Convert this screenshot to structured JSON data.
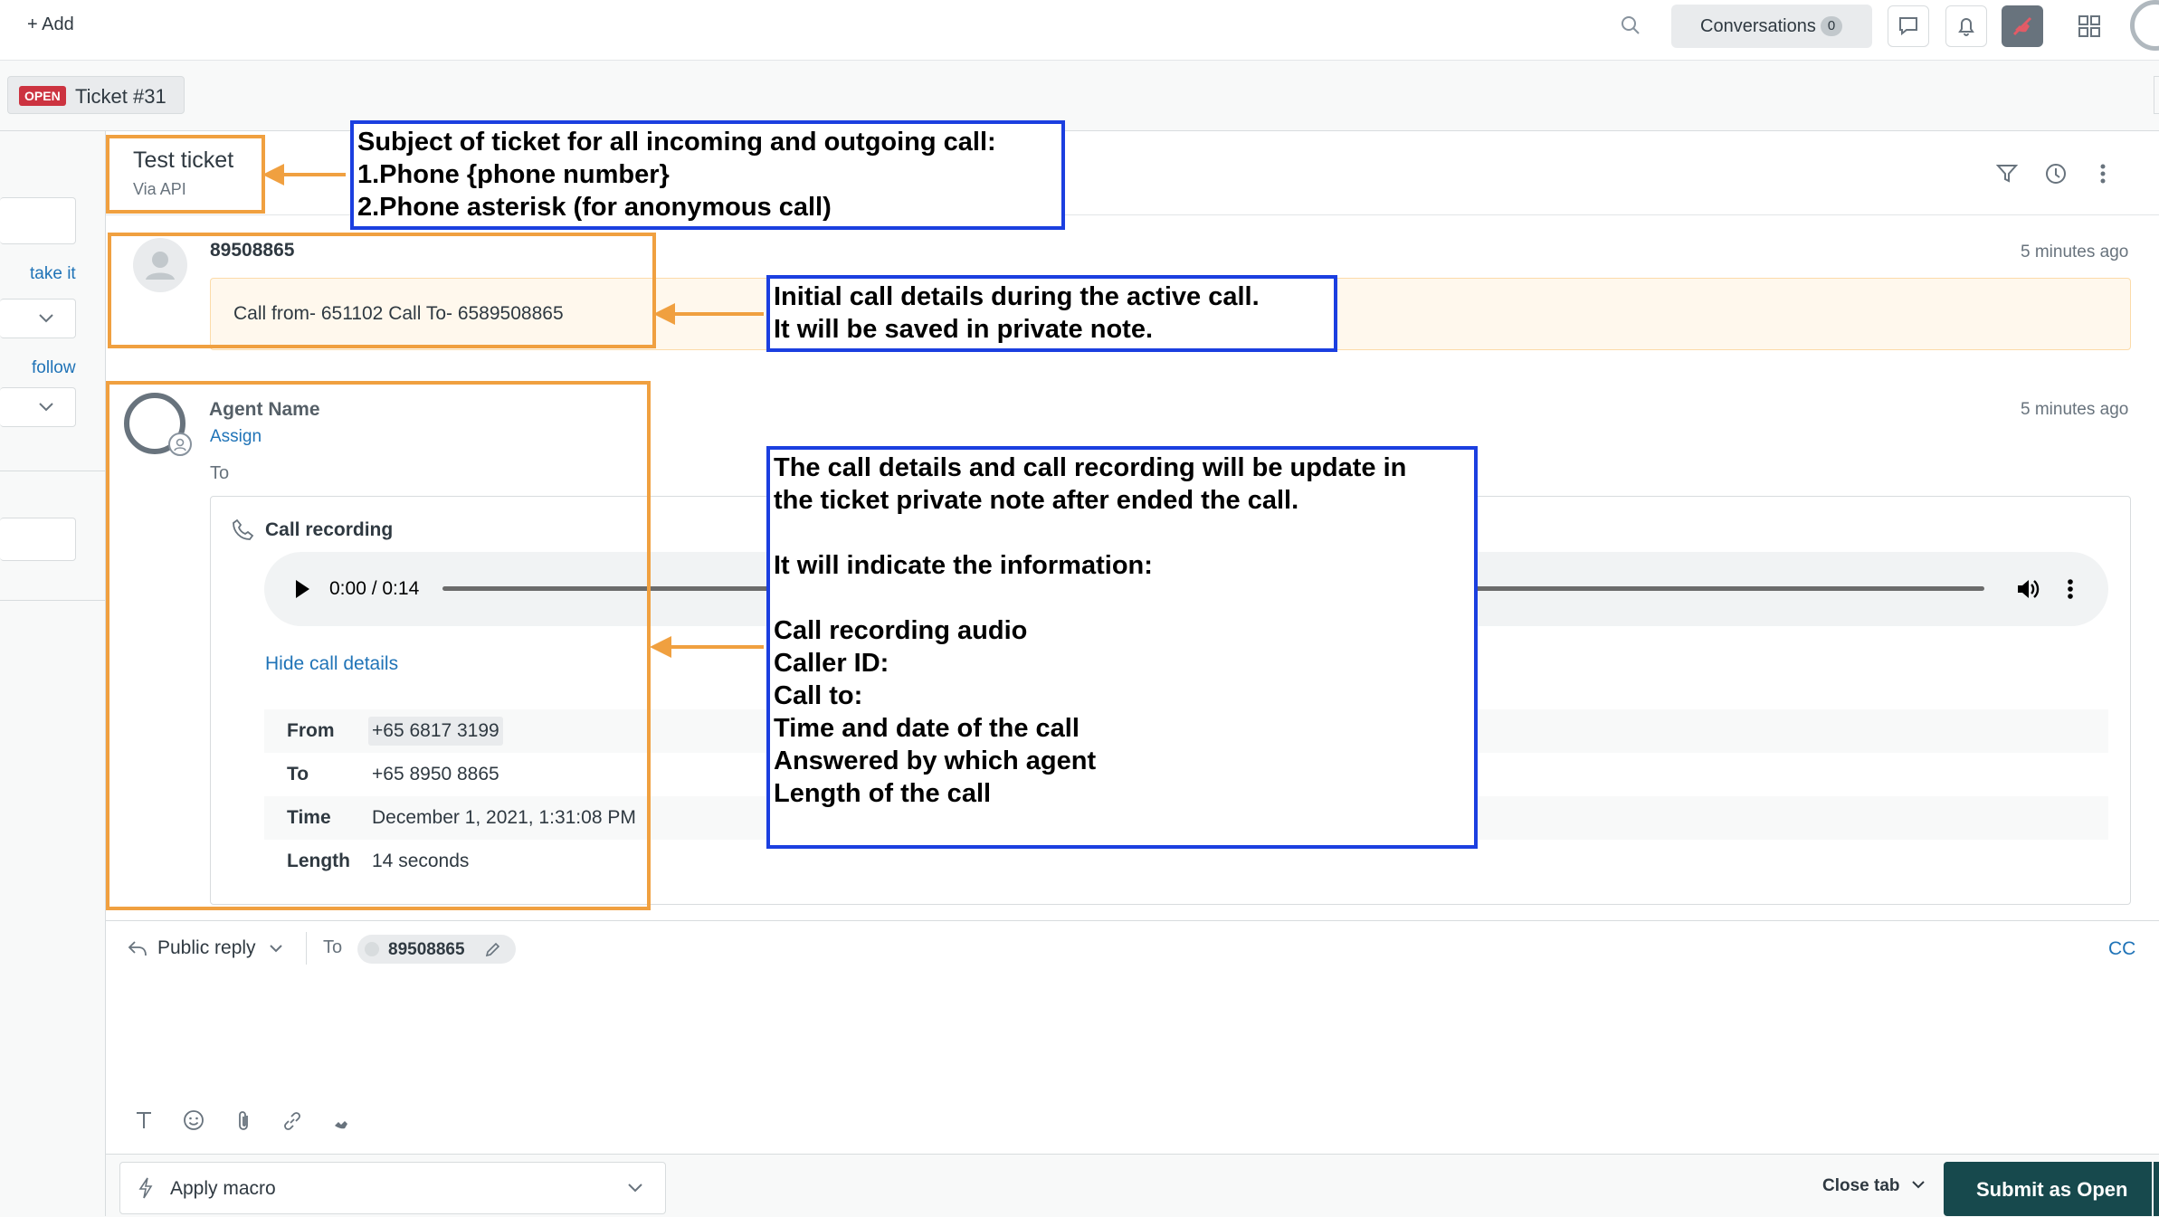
{
  "topbar": {
    "add_label": "+ Add",
    "conversations_label": "Conversations",
    "conversations_count": "0"
  },
  "tab": {
    "status_badge": "OPEN",
    "title": "Ticket #31"
  },
  "sidebar": {
    "take_it": "take it",
    "follow": "follow"
  },
  "ticket": {
    "subject": "Test ticket",
    "via": "Via API"
  },
  "note1": {
    "author": "89508865",
    "time": "5 minutes ago",
    "text": "Call from- 651102 Call To- 6589508865"
  },
  "note2": {
    "author": "Agent Name",
    "assign": "Assign",
    "to": "To",
    "time": "5 minutes ago",
    "recording_title": "Call recording",
    "audio_time": "0:00 / 0:14",
    "hide_details": "Hide call details",
    "details": [
      {
        "label": "From",
        "value": "+65 6817 3199"
      },
      {
        "label": "To",
        "value": "+65 8950 8865"
      },
      {
        "label": "Time",
        "value": "December 1, 2021, 1:31:08 PM"
      },
      {
        "label": "Length",
        "value": "14 seconds"
      }
    ]
  },
  "reply": {
    "mode": "Public reply",
    "to_label": "To",
    "recipient": "89508865",
    "cc": "CC"
  },
  "footer": {
    "apply_macro": "Apply macro",
    "close_tab": "Close tab",
    "submit_prefix": "Submit as ",
    "submit_status": "Open"
  },
  "annotations": {
    "subject_note": "Subject of ticket for all incoming and outgoing call:\n1.Phone {phone number}\n2.Phone asterisk (for anonymous call)",
    "initial_note": "Initial call details during the active call.\nIt will be saved in private note.",
    "recording_note": "The call details and call recording will be update in\nthe ticket private note after ended the call.\n\nIt will indicate the information:\n\nCall recording audio\nCaller ID:\nCall to:\nTime and date of the call\nAnswered by which agent\nLength of the call"
  },
  "colors": {
    "annotation_orange": "#f0a040",
    "annotation_blue": "#1b3fe0",
    "status_red": "#cc3340",
    "link_blue": "#1f73b7",
    "submit_bg": "#17494d"
  }
}
